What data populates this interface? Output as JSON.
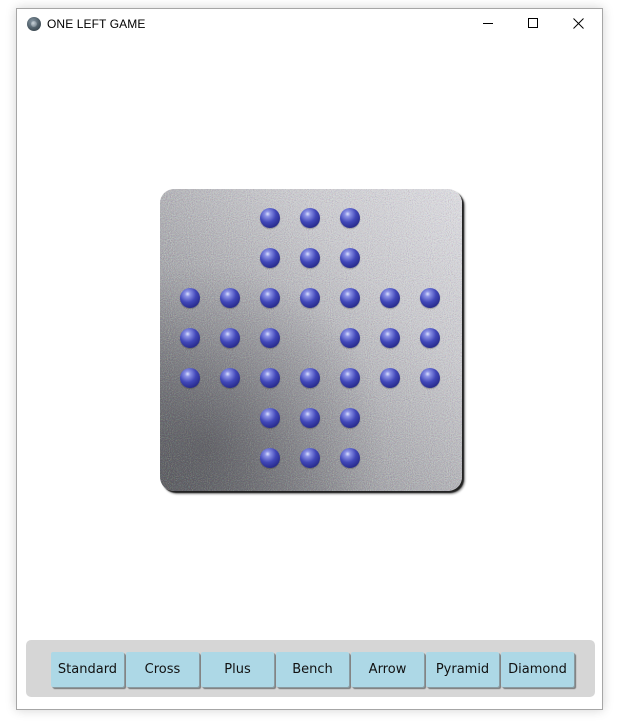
{
  "window": {
    "title": "ONE LEFT GAME",
    "controls": [
      "minimize",
      "maximize",
      "close"
    ]
  },
  "board": {
    "layout": "English cross",
    "grid": [
      "..XXX..",
      "..XXX..",
      "XXXXXXX",
      "XXX.XXX",
      "XXXXXXX",
      "..XXX..",
      "..XXX.."
    ],
    "peg_count": 32,
    "empty_holes": 1
  },
  "toolbar": {
    "buttons": [
      {
        "id": "standard",
        "label": "Standard"
      },
      {
        "id": "cross",
        "label": "Cross"
      },
      {
        "id": "plus",
        "label": "Plus"
      },
      {
        "id": "bench",
        "label": "Bench"
      },
      {
        "id": "arrow",
        "label": "Arrow"
      },
      {
        "id": "pyramid",
        "label": "Pyramid"
      },
      {
        "id": "diamond",
        "label": "Diamond"
      }
    ]
  },
  "colors": {
    "peg": "#3a3fb0",
    "hole": "#050505",
    "button_face": "#add8e6",
    "toolbar_bg": "#d6d6d6",
    "board_metal": "#a9a9ad"
  }
}
